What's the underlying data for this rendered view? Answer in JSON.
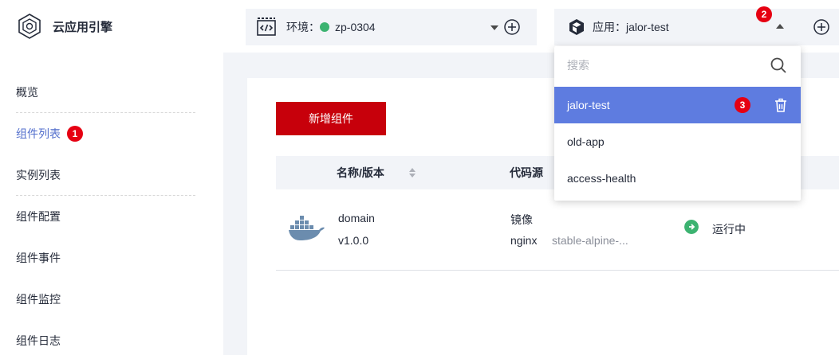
{
  "brand": {
    "name": "云应用引擎"
  },
  "sidebar": {
    "items": [
      {
        "label": "概览"
      },
      {
        "label": "组件列表",
        "marker": "1"
      },
      {
        "label": "实例列表"
      },
      {
        "label": "组件配置"
      },
      {
        "label": "组件事件"
      },
      {
        "label": "组件监控"
      },
      {
        "label": "组件日志"
      }
    ]
  },
  "topbar": {
    "env_label": "环境：",
    "env_value": "zp-0304",
    "env_status_color": "#3cb371",
    "app_label": "应用：jalor-test",
    "app_marker": "2"
  },
  "main": {
    "add_button": "新增组件",
    "table": {
      "headers": [
        "名称/版本",
        "代码源"
      ],
      "rows": [
        {
          "name": "domain",
          "version": "v1.0.0",
          "source_type": "镜像",
          "source_image": "nginx",
          "source_tag": "stable-alpine-...",
          "status": "运行中",
          "status_color": "#3cb371"
        }
      ]
    }
  },
  "dropdown": {
    "search_placeholder": "搜索",
    "items": [
      {
        "label": "jalor-test",
        "selected": true,
        "marker": "3"
      },
      {
        "label": "old-app"
      },
      {
        "label": "access-health"
      }
    ]
  },
  "colors": {
    "accent": "#526ecc",
    "primary_button": "#c7000b",
    "marker": "#e60012",
    "selected_item": "#5e7ce0"
  }
}
